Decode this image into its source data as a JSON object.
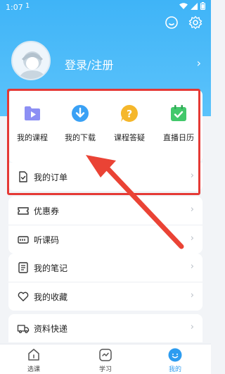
{
  "status_bar": {
    "time": "1:07",
    "sim": "1"
  },
  "header": {
    "login_label": "登录/注册",
    "chevron": "›"
  },
  "quick_grid": [
    {
      "label": "我的课程",
      "icon": "course-icon",
      "color": "#7b7ff0"
    },
    {
      "label": "我的下载",
      "icon": "download-icon",
      "color": "#3aa1f5"
    },
    {
      "label": "课程答疑",
      "icon": "question-icon",
      "color": "#f5b72b"
    },
    {
      "label": "直播日历",
      "icon": "calendar-icon",
      "color": "#42c86b"
    }
  ],
  "menu": {
    "orders": "我的订单",
    "coupons": "优惠券",
    "lesson_code": "听课码",
    "notes": "我的笔记",
    "favorites": "我的收藏",
    "materials": "资料快递"
  },
  "bottom_nav": [
    {
      "label": "选课",
      "icon": "home-icon",
      "active": false
    },
    {
      "label": "学习",
      "icon": "study-icon",
      "active": false
    },
    {
      "label": "我的",
      "icon": "profile-icon",
      "active": true
    }
  ],
  "colors": {
    "accent": "#2d9cf0",
    "header": "#4bbaf8",
    "highlight": "#e53935"
  }
}
